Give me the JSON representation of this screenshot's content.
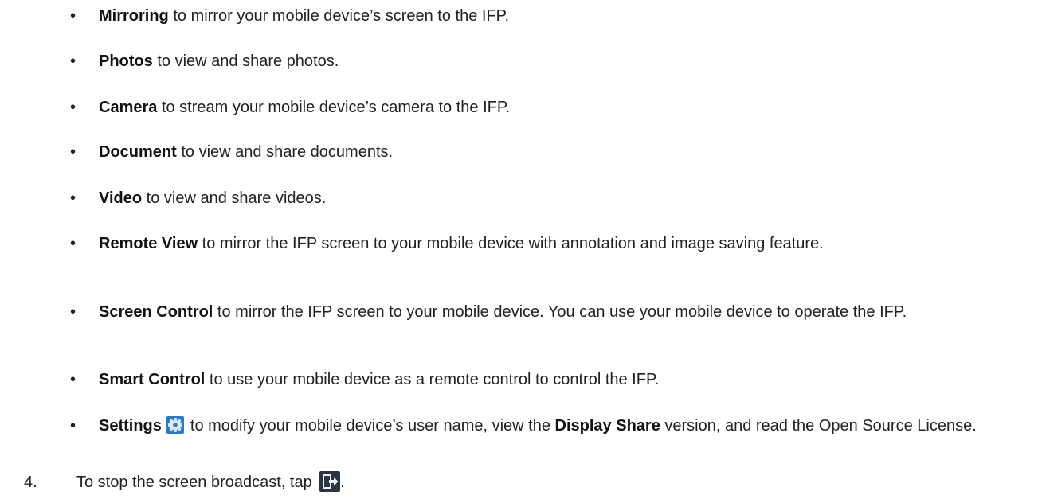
{
  "list": {
    "bullet": "•",
    "items": [
      {
        "term": "Mirroring",
        "desc": " to mirror your mobile device’s screen to the IFP."
      },
      {
        "term": "Photos",
        "desc": " to view and share photos."
      },
      {
        "term": "Camera",
        "desc": " to stream your mobile device’s camera to the IFP."
      },
      {
        "term": "Document",
        "desc": " to view and share documents."
      },
      {
        "term": "Video",
        "desc": " to view and share videos."
      },
      {
        "term": "Remote View",
        "desc": " to mirror the IFP screen to your mobile device with annotation and image saving feature."
      },
      {
        "term": "Screen Control",
        "desc": " to mirror the IFP screen to your mobile device. You can use your mobile device to operate the IFP."
      },
      {
        "term": "Smart Control",
        "desc": " to use your mobile device as a remote control to control the IFP."
      }
    ],
    "settings_item": {
      "term": "Settings",
      "icon": "settings-gear-icon",
      "desc_before": "to modify your mobile device’s user name, view the ",
      "app_name": "Display Share",
      "desc_after": " version, and read the Open Source License."
    }
  },
  "step": {
    "number": "4.",
    "text": "To stop the screen broadcast, tap ",
    "icon": "exit-broadcast-icon",
    "end": "."
  },
  "colors": {
    "text": "#222222",
    "icon_blue": "#2f78c4",
    "icon_dark": "#2b3440"
  }
}
